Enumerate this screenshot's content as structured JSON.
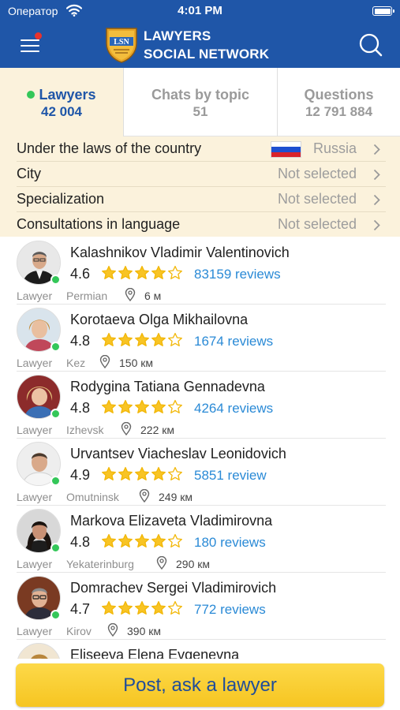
{
  "status_bar": {
    "carrier": "Оператор",
    "time": "4:01 PM"
  },
  "header": {
    "menu_badge_color": "#e8322d",
    "logo_mark": "LSN",
    "brand_line1": "LAWYERS",
    "brand_line2": "SOCIAL NETWORK",
    "accent_color": "#1f56a8"
  },
  "tabs": [
    {
      "label": "Lawyers",
      "count": "42 004",
      "active": true
    },
    {
      "label": "Chats by topic",
      "count": "51",
      "active": false
    },
    {
      "label": "Questions",
      "count": "12 791 884",
      "active": false
    }
  ],
  "filters": [
    {
      "label": "Under the laws of the country",
      "value": "Russia",
      "flag": "russia-flag-icon"
    },
    {
      "label": "City",
      "value": "Not selected"
    },
    {
      "label": "Specialization",
      "value": "Not selected"
    },
    {
      "label": "Consultations in language",
      "value": "Not selected"
    }
  ],
  "lawyers": [
    {
      "name": "Kalashnikov Vladimir Valentinovich",
      "rating": "4.6",
      "stars": 4,
      "reviews": "83159 reviews",
      "role": "Lawyer",
      "city": "Permian",
      "distance": "6 м",
      "online": true
    },
    {
      "name": "Korotaeva Olga Mikhailovna",
      "rating": "4.8",
      "stars": 4,
      "reviews": "1674 reviews",
      "role": "Lawyer",
      "city": "Kez",
      "distance": "150 км",
      "online": true
    },
    {
      "name": "Rodygina Tatiana Gennadevna",
      "rating": "4.8",
      "stars": 4,
      "reviews": "4264 reviews",
      "role": "Lawyer",
      "city": "Izhevsk",
      "distance": "222 км",
      "online": true
    },
    {
      "name": "Urvantsev Viacheslav Leonidovich",
      "rating": "4.9",
      "stars": 4,
      "reviews": "5851 review",
      "role": "Lawyer",
      "city": "Omutninsk",
      "distance": "249 км",
      "online": true
    },
    {
      "name": "Markova Elizaveta Vladimirovna",
      "rating": "4.8",
      "stars": 4,
      "reviews": "180 reviews",
      "role": "Lawyer",
      "city": "Yekaterinburg",
      "distance": "290 км",
      "online": true
    },
    {
      "name": "Domrachev Sergei Vladimirovich",
      "rating": "4.7",
      "stars": 4,
      "reviews": "772 reviews",
      "role": "Lawyer",
      "city": "Kirov",
      "distance": "390 км",
      "online": true
    },
    {
      "name": "Eliseeva Elena Evgenevna",
      "rating": "",
      "stars": 0,
      "reviews": "",
      "role": "",
      "city": "",
      "distance": "",
      "online": false
    }
  ],
  "cta": {
    "label": "Post, ask a lawyer",
    "color": "#fcd33a"
  }
}
